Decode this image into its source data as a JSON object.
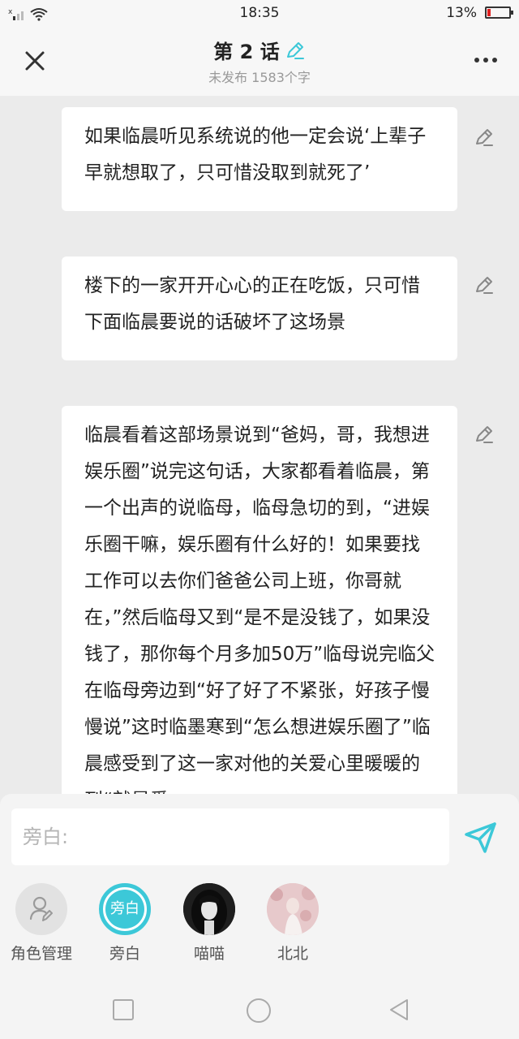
{
  "status_bar": {
    "time": "18:35",
    "battery": "13%",
    "battery_level": 0.13
  },
  "header": {
    "title": "第 2 话",
    "subtitle": "未发布 1583个字"
  },
  "cards": [
    {
      "text": "如果临晨听见系统说的他一定会说‘上辈子早就想取了，只可惜没取到就死了’"
    },
    {
      "text": "楼下的一家开开心心的正在吃饭，只可惜下面临晨要说的话破坏了这场景"
    },
    {
      "text": "临晨看着这部场景说到“爸妈，哥，我想进娱乐圈”说完这句话，大家都看着临晨，第一个出声的说临母，临母急切的到，“进娱乐圈干嘛，娱乐圈有什么好的！如果要找工作可以去你们爸爸公司上班，你哥就在，”然后临母又到“是不是没钱了，如果没钱了，那你每个月多加50万”临母说完临父在临母旁边到“好了好了不紧张，好孩子慢慢说”这时临墨寒到“怎么想进娱乐圈了”临晨感受到了这一家对他的关爱心里暖暖的到“就是爱"
    }
  ],
  "composer": {
    "placeholder": "旁白:"
  },
  "roles": [
    {
      "label": "角色管理",
      "avatar_text": ""
    },
    {
      "label": "旁白",
      "avatar_text": "旁白"
    },
    {
      "label": "喵喵",
      "avatar_text": ""
    },
    {
      "label": "北北",
      "avatar_text": ""
    }
  ],
  "colors": {
    "accent": "#3cc8d8",
    "background": "#ebebeb",
    "card": "#ffffff"
  }
}
